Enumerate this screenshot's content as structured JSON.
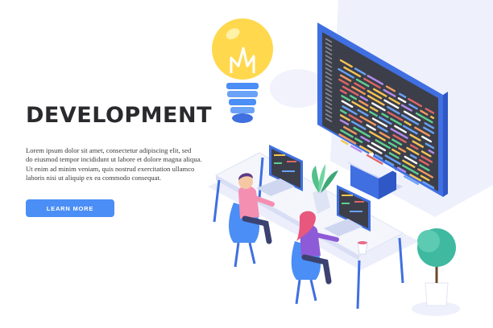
{
  "hero": {
    "title": "DEVELOPMENT",
    "body_lines": [
      "Lorem ipsum dolor sit amet, consectetur adipiscing elit, sed",
      "do eiusmod tempor incididunt ut labore et dolore magna aliqua.",
      "Ut enim ad minim veniam, quis nostrud exercitation ullamco",
      "laboris nisi ut aliquip ex ea commodo consequat."
    ],
    "cta_label": "LEARN MORE"
  },
  "illustration": {
    "icons": [
      "lightbulb-icon",
      "code-monitor-icon",
      "laptop-icon",
      "plant-icon",
      "coffee-cup-icon",
      "tree-icon"
    ],
    "colors": {
      "accent_blue": "#4b8ef5",
      "monitor_frame": "#3f6fe0",
      "screen_dark": "#3c3f4a",
      "bulb_yellow": "#ffd84d",
      "plant_green": "#55c08a",
      "developer_shirt_pink": "#f48fb1",
      "developer_shirt_purple": "#8e5bd8"
    }
  }
}
